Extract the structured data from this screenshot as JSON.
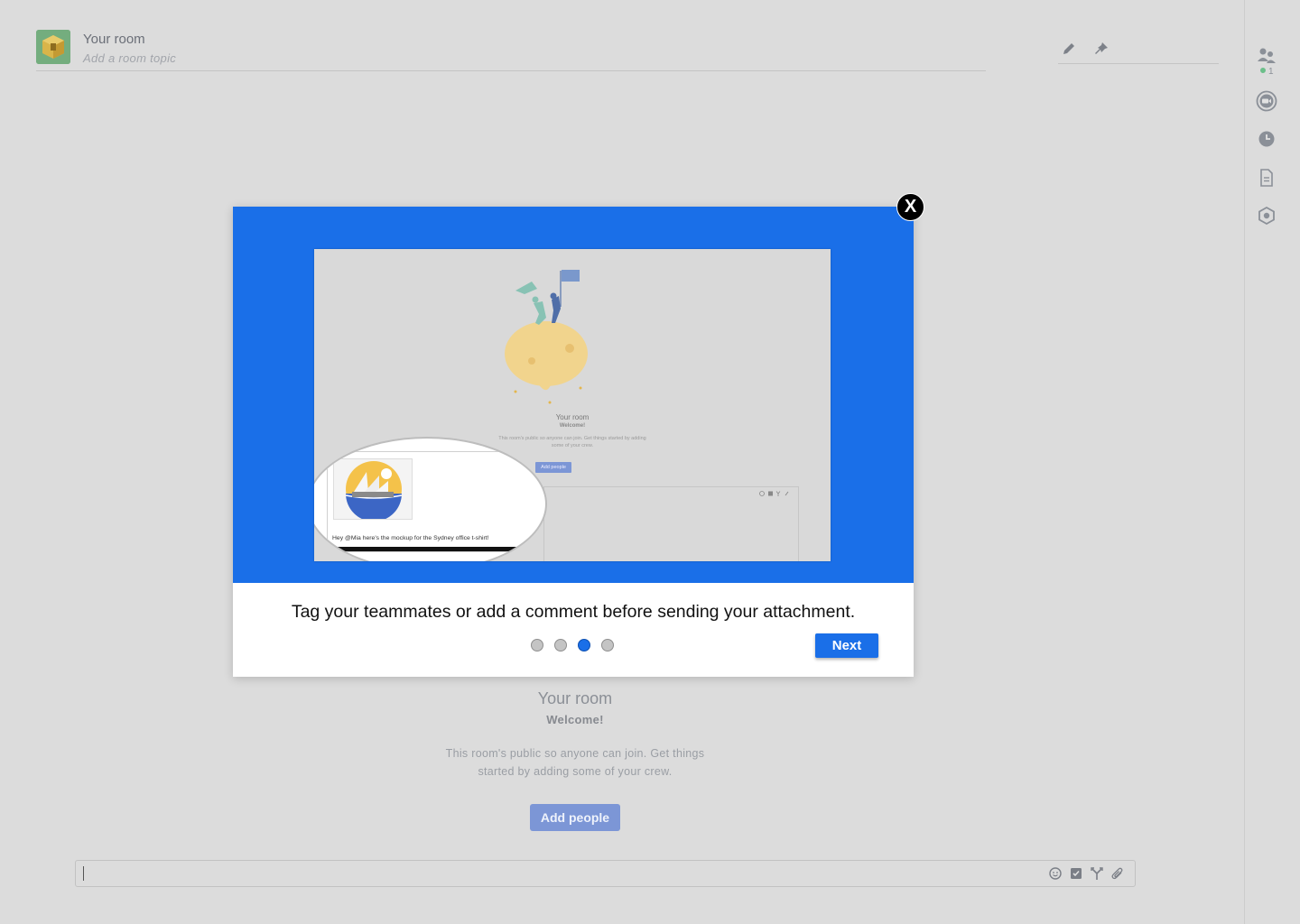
{
  "header": {
    "room_title": "Your room",
    "room_topic_placeholder": "Add a room topic"
  },
  "right_rail": {
    "presence_count": "1"
  },
  "welcome": {
    "title": "Your room",
    "subtitle": "Welcome!",
    "description": "This room's public so anyone can join. Get things started by adding some of your crew.",
    "add_people_label": "Add people"
  },
  "modal": {
    "close_label": "X",
    "caption": "Tag your teammates or add a comment before sending your attachment.",
    "next_label": "Next",
    "steps_total": 4,
    "active_step": 3,
    "hero_color": "#1a6fe8",
    "preview": {
      "title": "Your room",
      "subtitle": "Welcome!",
      "description": "This room's public so anyone can join. Get things started by adding some of your crew.",
      "button_label": "Add people",
      "message_text": "Hey @Mia here's the mockup for the Sydney office t-shirt!"
    }
  },
  "colors": {
    "accent": "#1a6fe8",
    "background": "#dcdcdc",
    "faded_button": "#7c96d6"
  }
}
